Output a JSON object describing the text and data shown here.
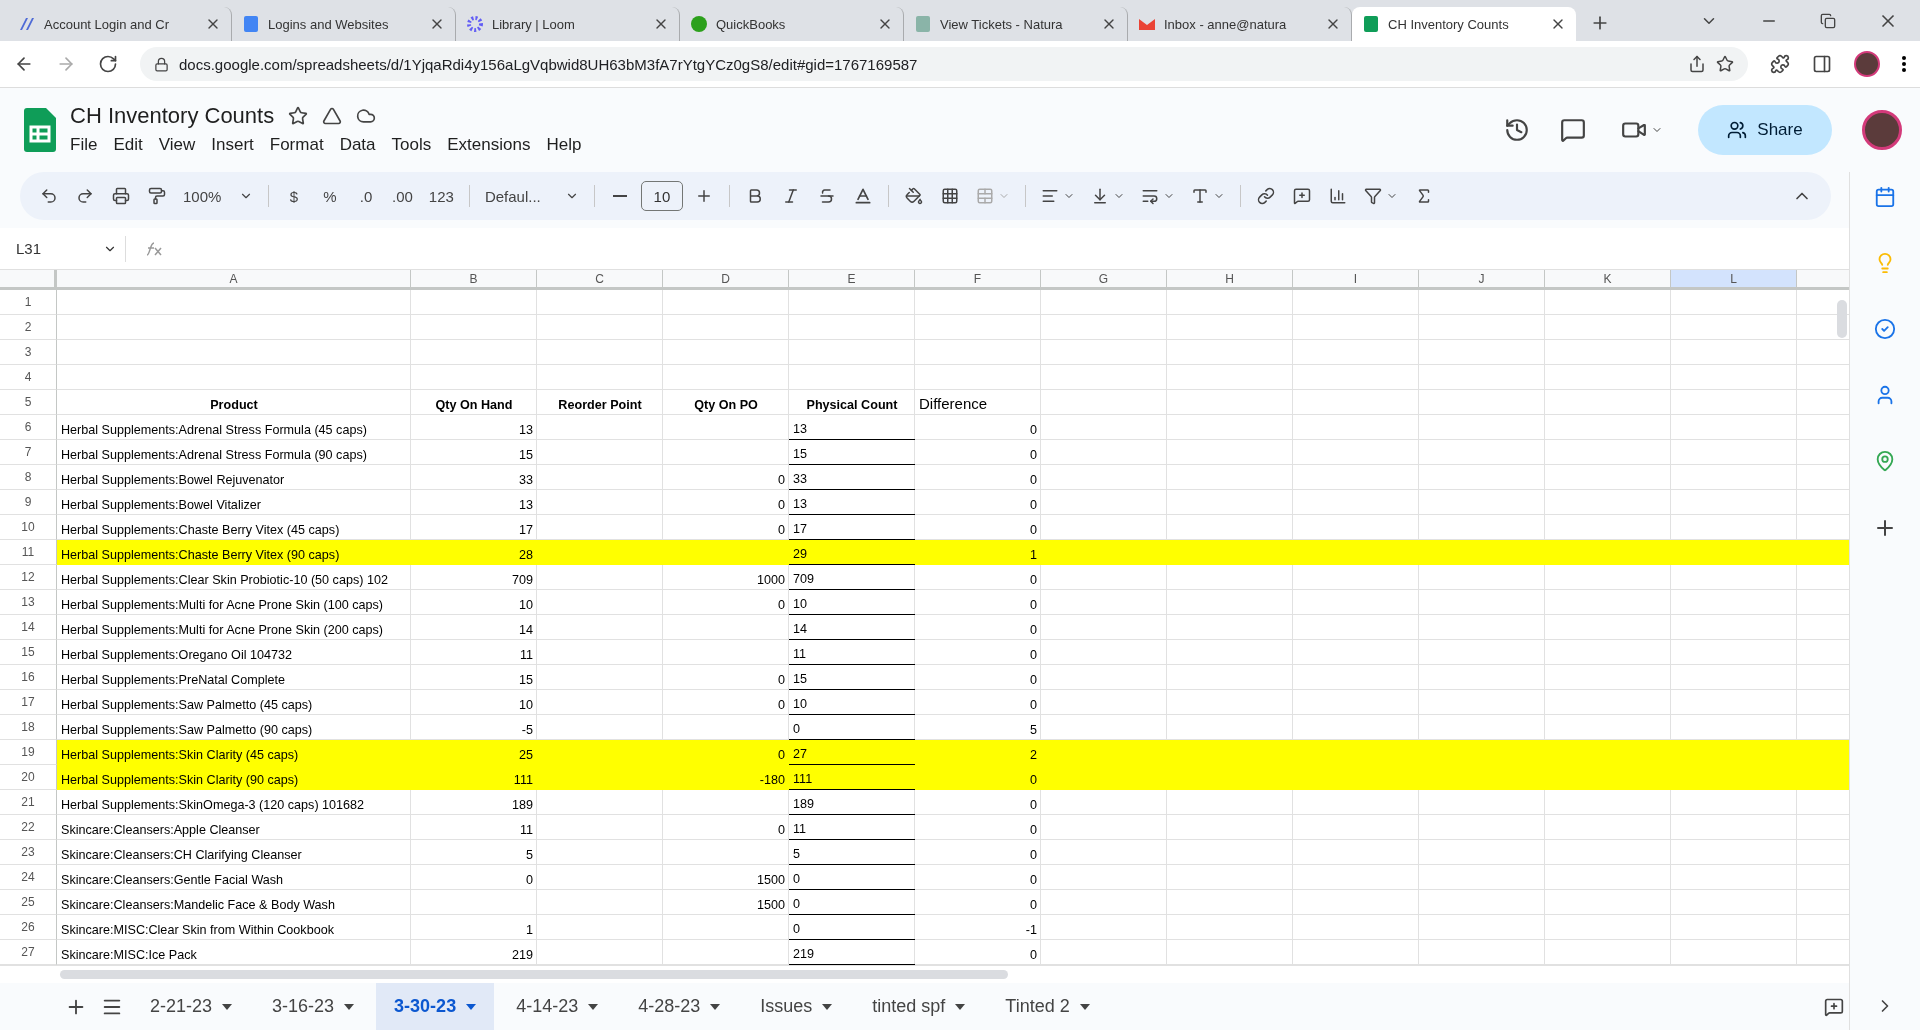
{
  "browser": {
    "tabs": [
      {
        "title": "Account Login and Cr",
        "selected": false
      },
      {
        "title": "Logins and Websites",
        "selected": false
      },
      {
        "title": "Library | Loom",
        "selected": false
      },
      {
        "title": "QuickBooks",
        "selected": false
      },
      {
        "title": "View Tickets - Natura",
        "selected": false
      },
      {
        "title": "Inbox - anne@natura",
        "selected": false
      },
      {
        "title": "CH Inventory Counts",
        "selected": true
      }
    ],
    "address": "docs.google.com/spreadsheets/d/1YjqaRdi4y156aLgVqbwid8UH63bM3fA7rYtgYCz0gS8/edit#gid=1767169587"
  },
  "doc": {
    "title": "CH Inventory Counts",
    "menus": [
      "File",
      "Edit",
      "View",
      "Insert",
      "Format",
      "Data",
      "Tools",
      "Extensions",
      "Help"
    ],
    "share": "Share"
  },
  "toolbar": {
    "zoom": "100%",
    "currency": "$",
    "percent": "%",
    "decrease_decimal": ".0",
    "increase_decimal": ".00",
    "number_format": "123",
    "font": "Defaul...",
    "font_size": "10"
  },
  "formula_bar": {
    "cell": "L31"
  },
  "sheet": {
    "columns": [
      {
        "label": "A",
        "selected": false
      },
      {
        "label": "B",
        "selected": false
      },
      {
        "label": "C",
        "selected": false
      },
      {
        "label": "D",
        "selected": false
      },
      {
        "label": "E",
        "selected": false
      },
      {
        "label": "F",
        "selected": false
      },
      {
        "label": "G",
        "selected": false
      },
      {
        "label": "H",
        "selected": false
      },
      {
        "label": "I",
        "selected": false
      },
      {
        "label": "J",
        "selected": false
      },
      {
        "label": "K",
        "selected": false
      },
      {
        "label": "L",
        "selected": true
      }
    ],
    "rows": [
      {
        "number": "1",
        "kind": "blank"
      },
      {
        "number": "2",
        "kind": "blank"
      },
      {
        "number": "3",
        "kind": "blank"
      },
      {
        "number": "4",
        "kind": "blank"
      },
      {
        "number": "5",
        "kind": "header",
        "cells": [
          {
            "text": "Product",
            "bold": true
          },
          {
            "text": "Qty On Hand",
            "bold": true
          },
          {
            "text": "Reorder Point",
            "bold": true
          },
          {
            "text": "Qty On PO",
            "bold": true
          },
          {
            "text": "Physical Count",
            "bold": true
          },
          {
            "text": "Difference",
            "bold": false
          }
        ]
      },
      {
        "number": "6",
        "kind": "item",
        "highlighted": false,
        "product": "Herbal Supplements:Adrenal Stress Formula (45 caps)",
        "on_hand": "13",
        "count": "13",
        "difference": "0"
      },
      {
        "number": "7",
        "kind": "item",
        "highlighted": false,
        "product": "Herbal Supplements:Adrenal Stress Formula (90 caps)",
        "on_hand": "15",
        "count": "15",
        "difference": "0"
      },
      {
        "number": "8",
        "kind": "item",
        "highlighted": false,
        "product": "Herbal Supplements:Bowel Rejuvenator",
        "on_hand": "33",
        "on_po": "0",
        "count": "33",
        "difference": "0"
      },
      {
        "number": "9",
        "kind": "item",
        "highlighted": false,
        "product": "Herbal Supplements:Bowel Vitalizer",
        "on_hand": "13",
        "on_po": "0",
        "count": "13",
        "difference": "0"
      },
      {
        "number": "10",
        "kind": "item",
        "highlighted": false,
        "product": "Herbal Supplements:Chaste Berry Vitex (45 caps)",
        "on_hand": "17",
        "on_po": "0",
        "count": "17",
        "difference": "0"
      },
      {
        "number": "11",
        "kind": "item",
        "highlighted": true,
        "product": "Herbal Supplements:Chaste Berry Vitex (90 caps)",
        "on_hand": "28",
        "count": "29",
        "difference": "1"
      },
      {
        "number": "12",
        "kind": "item",
        "highlighted": false,
        "product": "Herbal Supplements:Clear Skin Probiotic-10 (50 caps) 102",
        "on_hand": "709",
        "on_po": "1000",
        "count": "709",
        "difference": "0"
      },
      {
        "number": "13",
        "kind": "item",
        "highlighted": false,
        "product": "Herbal Supplements:Multi for Acne Prone Skin (100 caps)",
        "on_hand": "10",
        "on_po": "0",
        "count": "10",
        "difference": "0"
      },
      {
        "number": "14",
        "kind": "item",
        "highlighted": false,
        "product": "Herbal Supplements:Multi for Acne Prone Skin (200 caps)",
        "on_hand": "14",
        "count": "14",
        "difference": "0"
      },
      {
        "number": "15",
        "kind": "item",
        "highlighted": false,
        "product": "Herbal Supplements:Oregano Oil 104732",
        "on_hand": "11",
        "count": "11",
        "difference": "0"
      },
      {
        "number": "16",
        "kind": "item",
        "highlighted": false,
        "product": "Herbal Supplements:PreNatal Complete",
        "on_hand": "15",
        "on_po": "0",
        "count": "15",
        "difference": "0"
      },
      {
        "number": "17",
        "kind": "item",
        "highlighted": false,
        "product": "Herbal Supplements:Saw Palmetto (45 caps)",
        "on_hand": "10",
        "on_po": "0",
        "count": "10",
        "difference": "0"
      },
      {
        "number": "18",
        "kind": "item",
        "highlighted": false,
        "product": "Herbal Supplements:Saw Palmetto (90 caps)",
        "on_hand": "-5",
        "count": "0",
        "difference": "5"
      },
      {
        "number": "19",
        "kind": "item",
        "highlighted": true,
        "product": "Herbal Supplements:Skin Clarity (45 caps)",
        "on_hand": "25",
        "on_po": "0",
        "count": "27",
        "difference": "2"
      },
      {
        "number": "20",
        "kind": "item",
        "highlighted": true,
        "product": "Herbal Supplements:Skin Clarity (90 caps)",
        "on_hand": "111",
        "on_po": "-180",
        "count": "111",
        "difference": "0"
      },
      {
        "number": "21",
        "kind": "item",
        "highlighted": false,
        "product": "Herbal Supplements:SkinOmega-3 (120 caps) 101682",
        "on_hand": "189",
        "count": "189",
        "difference": "0"
      },
      {
        "number": "22",
        "kind": "item",
        "highlighted": false,
        "product": "Skincare:Cleansers:Apple Cleanser",
        "on_hand": "11",
        "on_po": "0",
        "count": "11",
        "difference": "0"
      },
      {
        "number": "23",
        "kind": "item",
        "highlighted": false,
        "product": "Skincare:Cleansers:CH Clarifying Cleanser",
        "on_hand": "5",
        "count": "5",
        "difference": "0"
      },
      {
        "number": "24",
        "kind": "item",
        "highlighted": false,
        "product": "Skincare:Cleansers:Gentle Facial Wash",
        "on_hand": "0",
        "on_po": "1500",
        "count": "0",
        "difference": "0"
      },
      {
        "number": "25",
        "kind": "item",
        "highlighted": false,
        "product": "Skincare:Cleansers:Mandelic Face & Body Wash",
        "on_po": "1500",
        "count": "0",
        "difference": "0"
      },
      {
        "number": "26",
        "kind": "item",
        "highlighted": false,
        "product": "Skincare:MISC:Clear Skin from Within Cookbook",
        "on_hand": "1",
        "count": "0",
        "difference": "-1"
      },
      {
        "number": "27",
        "kind": "item",
        "highlighted": false,
        "product": "Skincare:MISC:Ice Pack",
        "on_hand": "219",
        "count": "219",
        "difference": "0"
      }
    ]
  },
  "sheet_tabs": [
    {
      "label": "2-21-23",
      "selected": false
    },
    {
      "label": "3-16-23",
      "selected": false
    },
    {
      "label": "3-30-23",
      "selected": true
    },
    {
      "label": "4-14-23",
      "selected": false
    },
    {
      "label": "4-28-23",
      "selected": false
    },
    {
      "label": "Issues",
      "selected": false
    },
    {
      "label": "tinted spf",
      "selected": false
    },
    {
      "label": "Tinted 2",
      "selected": false
    }
  ]
}
